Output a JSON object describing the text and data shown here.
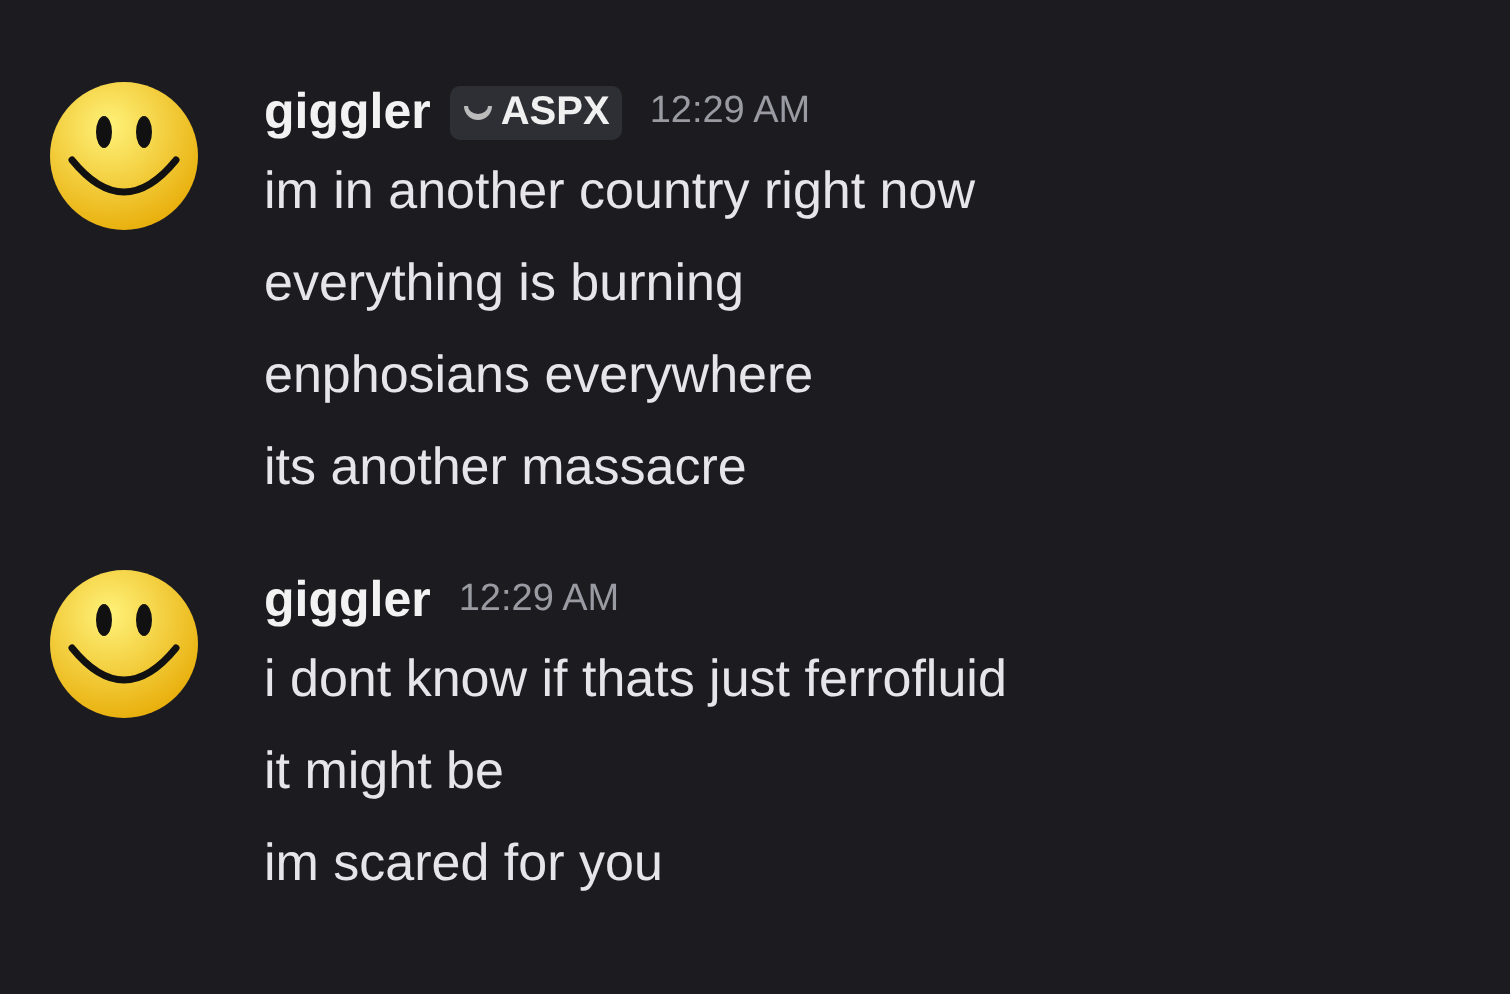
{
  "messages": [
    {
      "author": "giggler",
      "tag": {
        "text": "ASPX"
      },
      "time": "12:29 AM",
      "lines": [
        "im in another country right now",
        "everything is burning",
        "enphosians everywhere",
        "its another massacre"
      ]
    },
    {
      "author": "giggler",
      "time": "12:29 AM",
      "lines": [
        "i dont know if thats just ferrofluid",
        "it might be",
        "im scared for you"
      ]
    }
  ]
}
